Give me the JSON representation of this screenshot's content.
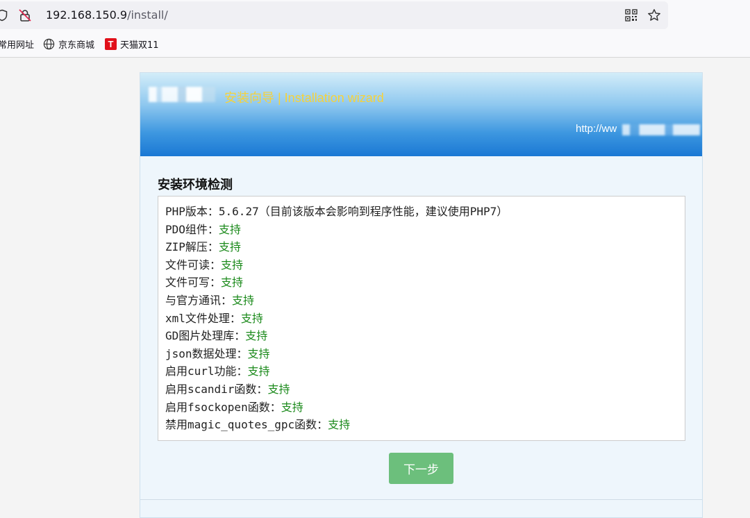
{
  "browser": {
    "url_host": "192.168.150.9",
    "url_path": "/install/",
    "bookmarks": [
      {
        "label": "常用网址"
      },
      {
        "label": "京东商城"
      },
      {
        "label": "天猫双11",
        "icon_letter": "T"
      }
    ]
  },
  "banner": {
    "title": "安装向导 | Installation wizard",
    "link_text": "http://ww"
  },
  "section_title": "安装环境检测",
  "checks": [
    {
      "label": "PHP版本：",
      "value": "5.6.27（目前该版本会影响到程序性能，建议使用PHP7）"
    },
    {
      "label": "PDO组件：",
      "value": "支持"
    },
    {
      "label": "ZIP解压：",
      "value": "支持"
    },
    {
      "label": "文件可读：",
      "value": "支持"
    },
    {
      "label": "文件可写：",
      "value": "支持"
    },
    {
      "label": "与官方通讯：",
      "value": "支持"
    },
    {
      "label": "xml文件处理：",
      "value": "支持"
    },
    {
      "label": "GD图片处理库：",
      "value": "支持"
    },
    {
      "label": "json数据处理：",
      "value": "支持"
    },
    {
      "label": "启用curl功能：",
      "value": "支持"
    },
    {
      "label": "启用scandir函数：",
      "value": "支持"
    },
    {
      "label": "启用fsockopen函数：",
      "value": "支持"
    },
    {
      "label": "禁用magic_quotes_gpc函数：",
      "value": "支持"
    }
  ],
  "next_button": "下一步",
  "colors": {
    "title_yellow": "#f6d23a",
    "support_green": "#1b8a1b",
    "button_green": "#6cbf7c"
  }
}
